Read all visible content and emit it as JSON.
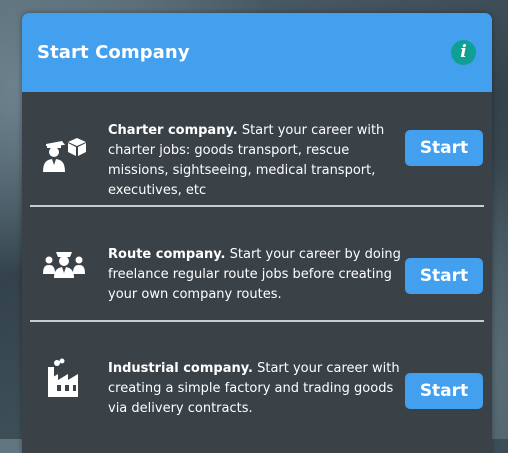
{
  "header": {
    "title": "Start Company",
    "info_icon": "info-icon",
    "accent": "#42a0ef"
  },
  "companies": [
    {
      "name": "Charter company.",
      "description": " Start your career with charter jobs: goods transport, rescue missions, sightseeing, medical transport, executives, etc",
      "icon": "charter-pilot-package-icon",
      "button": "Start"
    },
    {
      "name": "Route company.",
      "description": " Start your career by doing freelance regular route jobs before creating your own company routes.",
      "icon": "route-pilot-passengers-icon",
      "button": "Start"
    },
    {
      "name": "Industrial company.",
      "description": " Start your career with creating a simple factory and trading goods via delivery contracts.",
      "icon": "factory-icon",
      "button": "Start"
    }
  ]
}
